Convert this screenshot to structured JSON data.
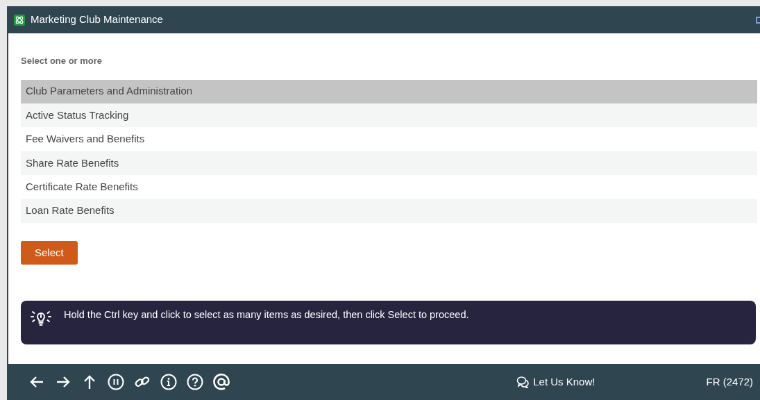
{
  "window": {
    "title": "Marketing Club Maintenance"
  },
  "prompt": "Select one or more",
  "items": [
    {
      "label": "Club Parameters and Administration",
      "selected": true
    },
    {
      "label": "Active Status Tracking",
      "selected": false
    },
    {
      "label": "Fee Waivers and Benefits",
      "selected": false
    },
    {
      "label": "Share Rate Benefits",
      "selected": false
    },
    {
      "label": "Certificate Rate Benefits",
      "selected": false
    },
    {
      "label": "Loan Rate Benefits",
      "selected": false
    }
  ],
  "select_button": "Select",
  "hint": "Hold the Ctrl key and click to select as many items as desired, then click Select to proceed.",
  "status_bar": {
    "feedback": "Let Us Know!",
    "user": "FR (2472)"
  }
}
